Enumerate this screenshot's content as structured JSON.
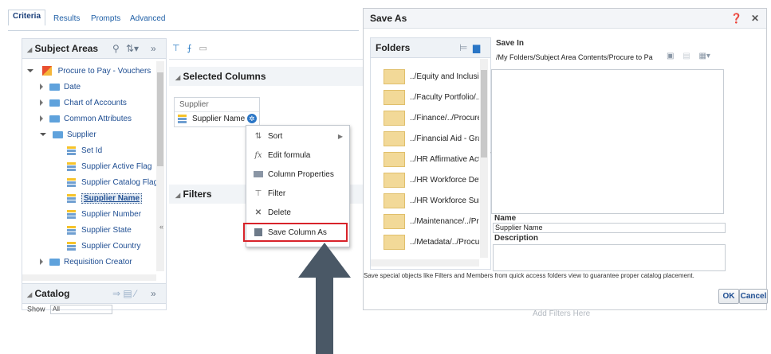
{
  "tabs": [
    "Criteria",
    "Results",
    "Prompts",
    "Advanced"
  ],
  "subject_areas": {
    "title": "Subject Areas",
    "tree": [
      {
        "label": "Procure to Pay - Vouchers",
        "type": "subject"
      },
      {
        "label": "Date",
        "type": "folder"
      },
      {
        "label": "Chart of Accounts",
        "type": "folder"
      },
      {
        "label": "Common Attributes",
        "type": "folder"
      },
      {
        "label": "Supplier",
        "type": "folder"
      },
      {
        "label": "Set Id",
        "type": "column"
      },
      {
        "label": "Supplier Active Flag",
        "type": "column"
      },
      {
        "label": "Supplier Catalog Flag",
        "type": "column"
      },
      {
        "label": "Supplier Name",
        "type": "column",
        "selected": true
      },
      {
        "label": "Supplier Number",
        "type": "column"
      },
      {
        "label": "Supplier State",
        "type": "column"
      },
      {
        "label": "Supplier Country",
        "type": "column"
      },
      {
        "label": "Requisition Creator",
        "type": "folder"
      }
    ]
  },
  "catalog": {
    "title": "Catalog",
    "show_label": "Show",
    "show_value": "All"
  },
  "selected_columns": {
    "title": "Selected Columns",
    "group_label": "Supplier",
    "column": "Supplier Name"
  },
  "filters": {
    "title": "Filters",
    "placeholder": "Add Filters Here"
  },
  "context_menu": [
    {
      "label": "Sort",
      "icon": "sort-icon",
      "submenu": true
    },
    {
      "label": "Edit formula",
      "icon": "formula-icon"
    },
    {
      "label": "Column Properties",
      "icon": "properties-icon"
    },
    {
      "label": "Filter",
      "icon": "filter-icon"
    },
    {
      "label": "Delete",
      "icon": "delete-icon"
    },
    {
      "label": "Save Column As",
      "icon": "save-icon",
      "highlighted": true
    }
  ],
  "save_as_dialog": {
    "title": "Save As",
    "folders_title": "Folders",
    "folders": [
      "../Equity and Inclusion",
      "../Faculty Portfolio/../P",
      "../Finance/../Procure tc",
      "../Financial Aid - Grad",
      "../HR Affirmative Actio",
      "../HR Workforce Detail",
      "../HR Workforce Summ",
      "../Maintenance/../Proce",
      "../Metadata/../Procure"
    ],
    "save_in_label": "Save In",
    "save_in_value": "/My Folders/Subject Area Contents/Procure to Pa",
    "name_label": "Name",
    "name_value": "Supplier Name",
    "description_label": "Description",
    "note": "Save special objects like Filters and Members from quick access folders view to guarantee proper catalog placement.",
    "ok_label": "OK",
    "cancel_label": "Cancel"
  },
  "colors": {
    "highlight_box": "#d8232a",
    "arrow": "#4a5866",
    "link": "#1f4e92"
  }
}
